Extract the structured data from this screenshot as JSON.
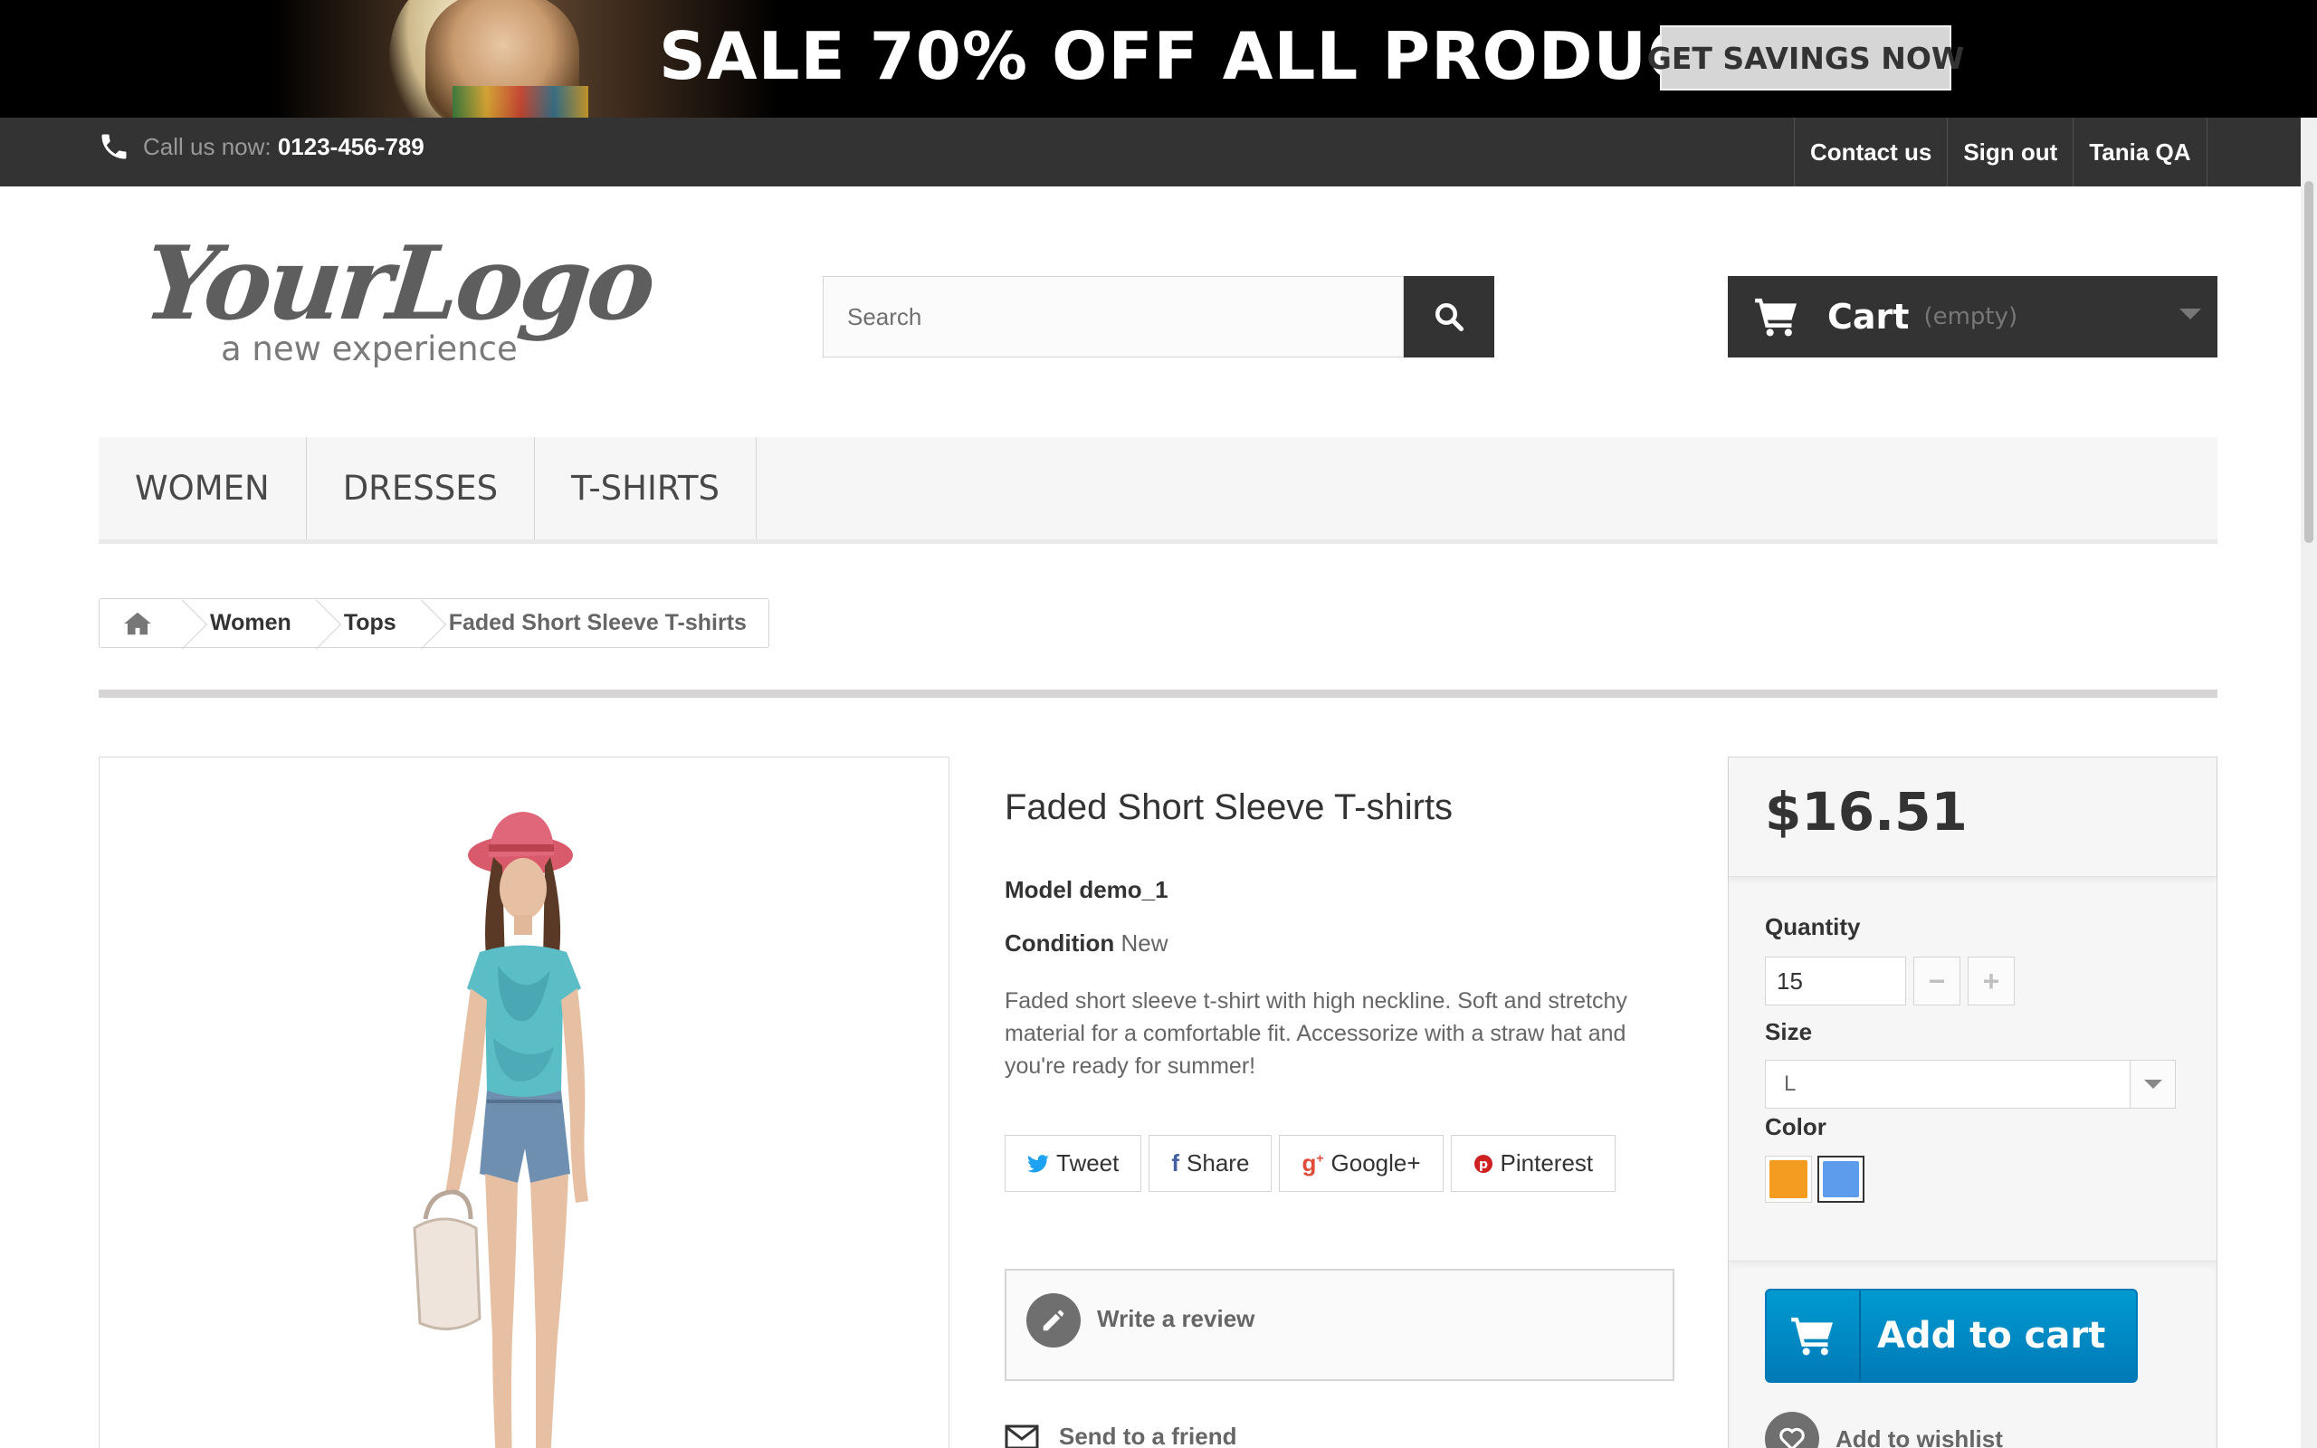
{
  "banner": {
    "text": "SALE 70% OFF ALL PRODUCTS",
    "button": "GET SAVINGS NOW"
  },
  "topbar": {
    "call_label": "Call us now: ",
    "phone": "0123-456-789",
    "links": [
      "Contact us",
      "Sign out",
      "Tania QA"
    ]
  },
  "header": {
    "logo_main": "YourLogo",
    "logo_sub": "a new experience",
    "search_placeholder": "Search",
    "cart_label": "Cart",
    "cart_status": "(empty)"
  },
  "menu": [
    "WOMEN",
    "DRESSES",
    "T-SHIRTS"
  ],
  "breadcrumb": {
    "items": [
      "Women",
      "Tops"
    ],
    "current": "Faded Short Sleeve T-shirts"
  },
  "product": {
    "title": "Faded Short Sleeve T-shirts",
    "model_label": "Model",
    "model": "demo_1",
    "condition_label": "Condition",
    "condition": "New",
    "description": "Faded short sleeve t-shirt with high neckline. Soft and stretchy material for a comfortable fit. Accessorize with a straw hat and you're ready for summer!",
    "share": {
      "tweet": "Tweet",
      "share": "Share",
      "google": "Google+",
      "pinterest": "Pinterest"
    },
    "write_review": "Write a review",
    "send_friend": "Send to a friend"
  },
  "buy": {
    "price": "$16.51",
    "quantity_label": "Quantity",
    "quantity": "15",
    "size_label": "Size",
    "size": "L",
    "color_label": "Color",
    "colors": [
      "#f39c1f",
      "#5d9cec"
    ],
    "selected_color_index": 1,
    "add_to_cart": "Add to cart",
    "wishlist": "Add to wishlist"
  }
}
